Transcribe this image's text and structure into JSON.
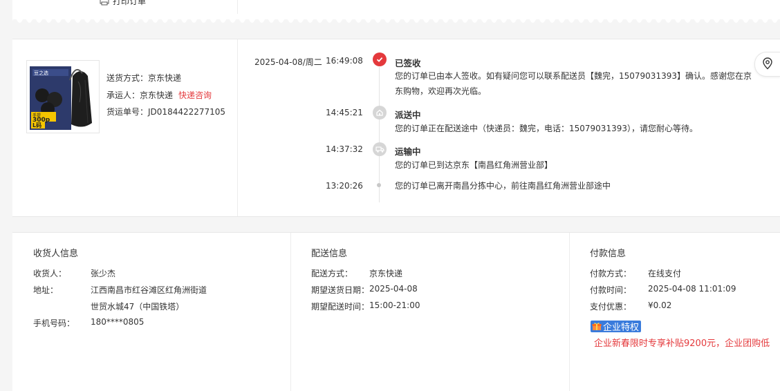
{
  "top": {
    "print_label": "打印订单"
  },
  "logistics": {
    "ship_method_label": "送货方式：",
    "ship_method": "京东快递",
    "carrier_label": "承运人：",
    "carrier": "京东快递",
    "consult_link": "快递咨询",
    "tracking_label": "货运单号：",
    "tracking_no": "JD0184422277105",
    "product": {
      "brand": "豆之选",
      "count": "300p",
      "size": "L码",
      "small": "手提"
    },
    "date": "2025-04-08/周二",
    "events": [
      {
        "time": "16:49:08",
        "title": "已签收",
        "desc": "您的订单已由本人签收。如有疑问您可以联系配送员【魏完，15079031393】确认。感谢您在京东购物，欢迎再次光临。",
        "icon": "check-icon"
      },
      {
        "time": "14:45:21",
        "title": "派送中",
        "desc": "您的订单正在配送途中（快递员：魏完，电话：15079031393），请您耐心等待。",
        "icon": "delivery-icon"
      },
      {
        "time": "14:37:32",
        "title": "运输中",
        "desc": "您的订单已到达京东【南昌红角洲营业部】",
        "icon": "transit-icon"
      },
      {
        "time": "13:20:26",
        "title": "",
        "desc": "您的订单已离开南昌分拣中心，前往南昌红角洲营业部途中",
        "icon": "dot"
      }
    ]
  },
  "receiver": {
    "title": "收货人信息",
    "name_label": "收货人：",
    "name": "张少杰",
    "address_label": "地址：",
    "address_line1": "江西南昌市红谷滩区红角洲街道",
    "address_line2": "世贸水城47（中国铁塔）",
    "phone_label": "手机号码：",
    "phone": "180****0805"
  },
  "delivery": {
    "title": "配送信息",
    "method_label": "配送方式：",
    "method": "京东快递",
    "date_label": "期望送货日期：",
    "date": "2025-04-08",
    "time_label": "期望配送时间：",
    "time": "15:00-21:00"
  },
  "payment": {
    "title": "付款信息",
    "method_label": "付款方式：",
    "method": "在线支付",
    "time_label": "付款时间：",
    "time": "2025-04-08 11:01:09",
    "discount_label": "支付优惠：",
    "discount": "¥0.02",
    "badge": "企业特权",
    "promo": "企业新春限时专享补贴9200元，企业团购低"
  },
  "colors": {
    "accent": "#e4393c",
    "badge": "#3a7bdc"
  }
}
